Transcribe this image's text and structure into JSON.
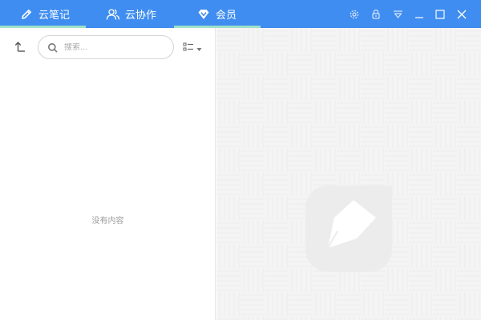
{
  "tabs": [
    {
      "label": "云笔记",
      "icon": "pencil-icon",
      "active": true
    },
    {
      "label": "云协作",
      "icon": "users-icon",
      "active": false
    },
    {
      "label": "会员",
      "icon": "diamond-icon",
      "active": false
    }
  ],
  "window_controls": [
    "settings-icon",
    "lock-icon",
    "dropdown-menu-icon",
    "minimize-icon",
    "maximize-icon",
    "close-icon"
  ],
  "toolbar": {
    "up_icon": "navigate-up-icon",
    "view_icon": "list-view-icon"
  },
  "search": {
    "placeholder": "搜索..."
  },
  "note_list": {
    "empty_text": "没有内容"
  },
  "colors": {
    "titlebar": "#3f8df0",
    "tab_underline": "#9de0c9",
    "right_panel_bg": "#f4f4f4"
  }
}
